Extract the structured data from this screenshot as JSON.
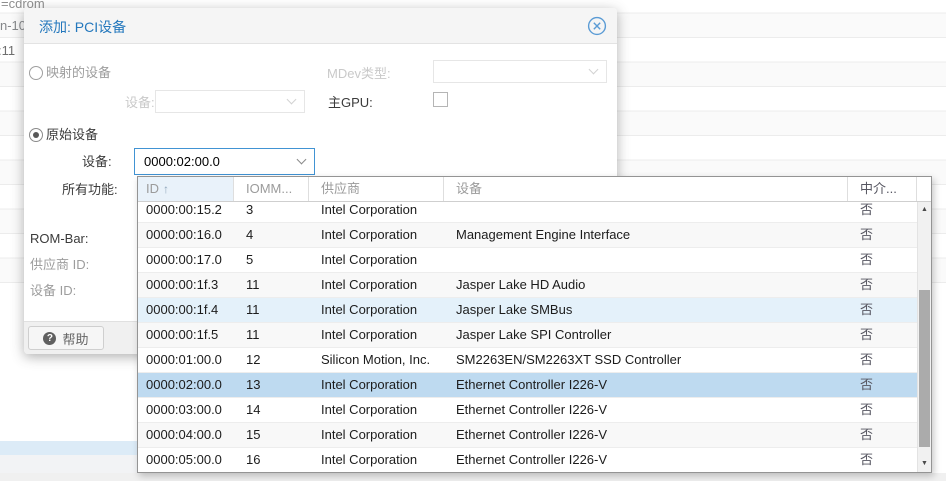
{
  "background": {
    "fragments": [
      {
        "text": "=cdrom"
      },
      {
        "text": "n-10"
      },
      {
        "text": ":11"
      }
    ]
  },
  "dialog": {
    "title": "添加: PCI设备",
    "mapped_radio_label": "映射的设备",
    "mdev_type_label": "MDev类型:",
    "mapped_device_label": "设备:",
    "primary_gpu_label": "主GPU:",
    "raw_radio_label": "原始设备",
    "device_label": "设备:",
    "device_value": "0000:02:00.0",
    "all_functions_label": "所有功能:",
    "rom_bar_label": "ROM-Bar:",
    "vendor_id_label": "供应商 ID:",
    "device_id_label": "设备 ID:",
    "help_button": {
      "label": "帮助",
      "icon_glyph": "?"
    }
  },
  "picker": {
    "columns": [
      {
        "label": "ID",
        "sorted": "asc"
      },
      {
        "label": "IOMM..."
      },
      {
        "label": "供应商"
      },
      {
        "label": "设备"
      },
      {
        "label": "中介..."
      }
    ],
    "icons": {
      "sort_asc": "↑",
      "scroll_up": "▲",
      "scroll_down": "▼"
    },
    "rows": [
      {
        "id": "0000:00:15.2",
        "iommu": "3",
        "vendor": "Intel Corporation",
        "device": "",
        "mediated": "否",
        "state": ""
      },
      {
        "id": "0000:00:16.0",
        "iommu": "4",
        "vendor": "Intel Corporation",
        "device": "Management Engine Interface",
        "mediated": "否",
        "state": ""
      },
      {
        "id": "0000:00:17.0",
        "iommu": "5",
        "vendor": "Intel Corporation",
        "device": "",
        "mediated": "否",
        "state": ""
      },
      {
        "id": "0000:00:1f.3",
        "iommu": "11",
        "vendor": "Intel Corporation",
        "device": "Jasper Lake HD Audio",
        "mediated": "否",
        "state": ""
      },
      {
        "id": "0000:00:1f.4",
        "iommu": "11",
        "vendor": "Intel Corporation",
        "device": "Jasper Lake SMBus",
        "mediated": "否",
        "state": "hover"
      },
      {
        "id": "0000:00:1f.5",
        "iommu": "11",
        "vendor": "Intel Corporation",
        "device": "Jasper Lake SPI Controller",
        "mediated": "否",
        "state": ""
      },
      {
        "id": "0000:01:00.0",
        "iommu": "12",
        "vendor": "Silicon Motion, Inc.",
        "device": "SM2263EN/SM2263XT SSD Controller",
        "mediated": "否",
        "state": ""
      },
      {
        "id": "0000:02:00.0",
        "iommu": "13",
        "vendor": "Intel Corporation",
        "device": "Ethernet Controller I226-V",
        "mediated": "否",
        "state": "selected"
      },
      {
        "id": "0000:03:00.0",
        "iommu": "14",
        "vendor": "Intel Corporation",
        "device": "Ethernet Controller I226-V",
        "mediated": "否",
        "state": ""
      },
      {
        "id": "0000:04:00.0",
        "iommu": "15",
        "vendor": "Intel Corporation",
        "device": "Ethernet Controller I226-V",
        "mediated": "否",
        "state": ""
      },
      {
        "id": "0000:05:00.0",
        "iommu": "16",
        "vendor": "Intel Corporation",
        "device": "Ethernet Controller I226-V",
        "mediated": "否",
        "state": ""
      }
    ]
  },
  "colors": {
    "title_blue": "#2478bd",
    "focus_border": "#4193d3",
    "selected_row": "#bedaf0",
    "hover_row": "#e4f1fa",
    "sorted_header_bg": "#e9f2fa"
  }
}
